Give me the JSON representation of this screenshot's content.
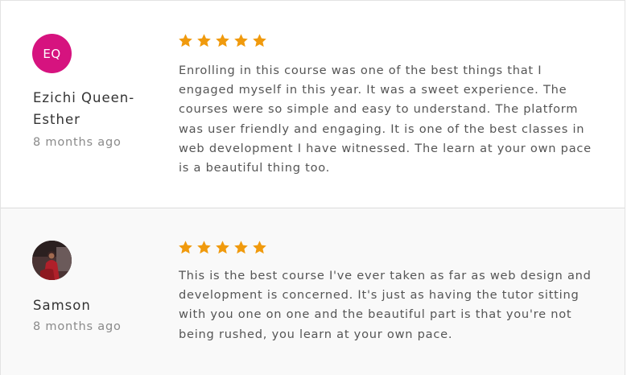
{
  "reviews": [
    {
      "initials": "EQ",
      "avatar_color": "#d6137f",
      "name": "Ezichi Queen-Esther",
      "time": "8 months ago",
      "rating": 5,
      "text": "Enrolling in this course was one of the best things that I engaged myself in this year. It was a sweet experience. The courses were so simple and easy to understand. The platform was user friendly and engaging. It is one of the best classes in web development I have witnessed. The learn at your own pace is a beautiful thing too."
    },
    {
      "avatar_type": "photo",
      "name": "Samson",
      "time": "8 months ago",
      "rating": 5,
      "text": "This is the best course I've ever taken as far as web design and development is concerned. It's just as having the tutor sitting with you one on one and the beautiful part is that you're not being rushed, you learn at your own pace."
    }
  ],
  "colors": {
    "star": "#f09a0d",
    "name": "#333333",
    "meta": "#8a8a8a",
    "body": "#555555"
  }
}
